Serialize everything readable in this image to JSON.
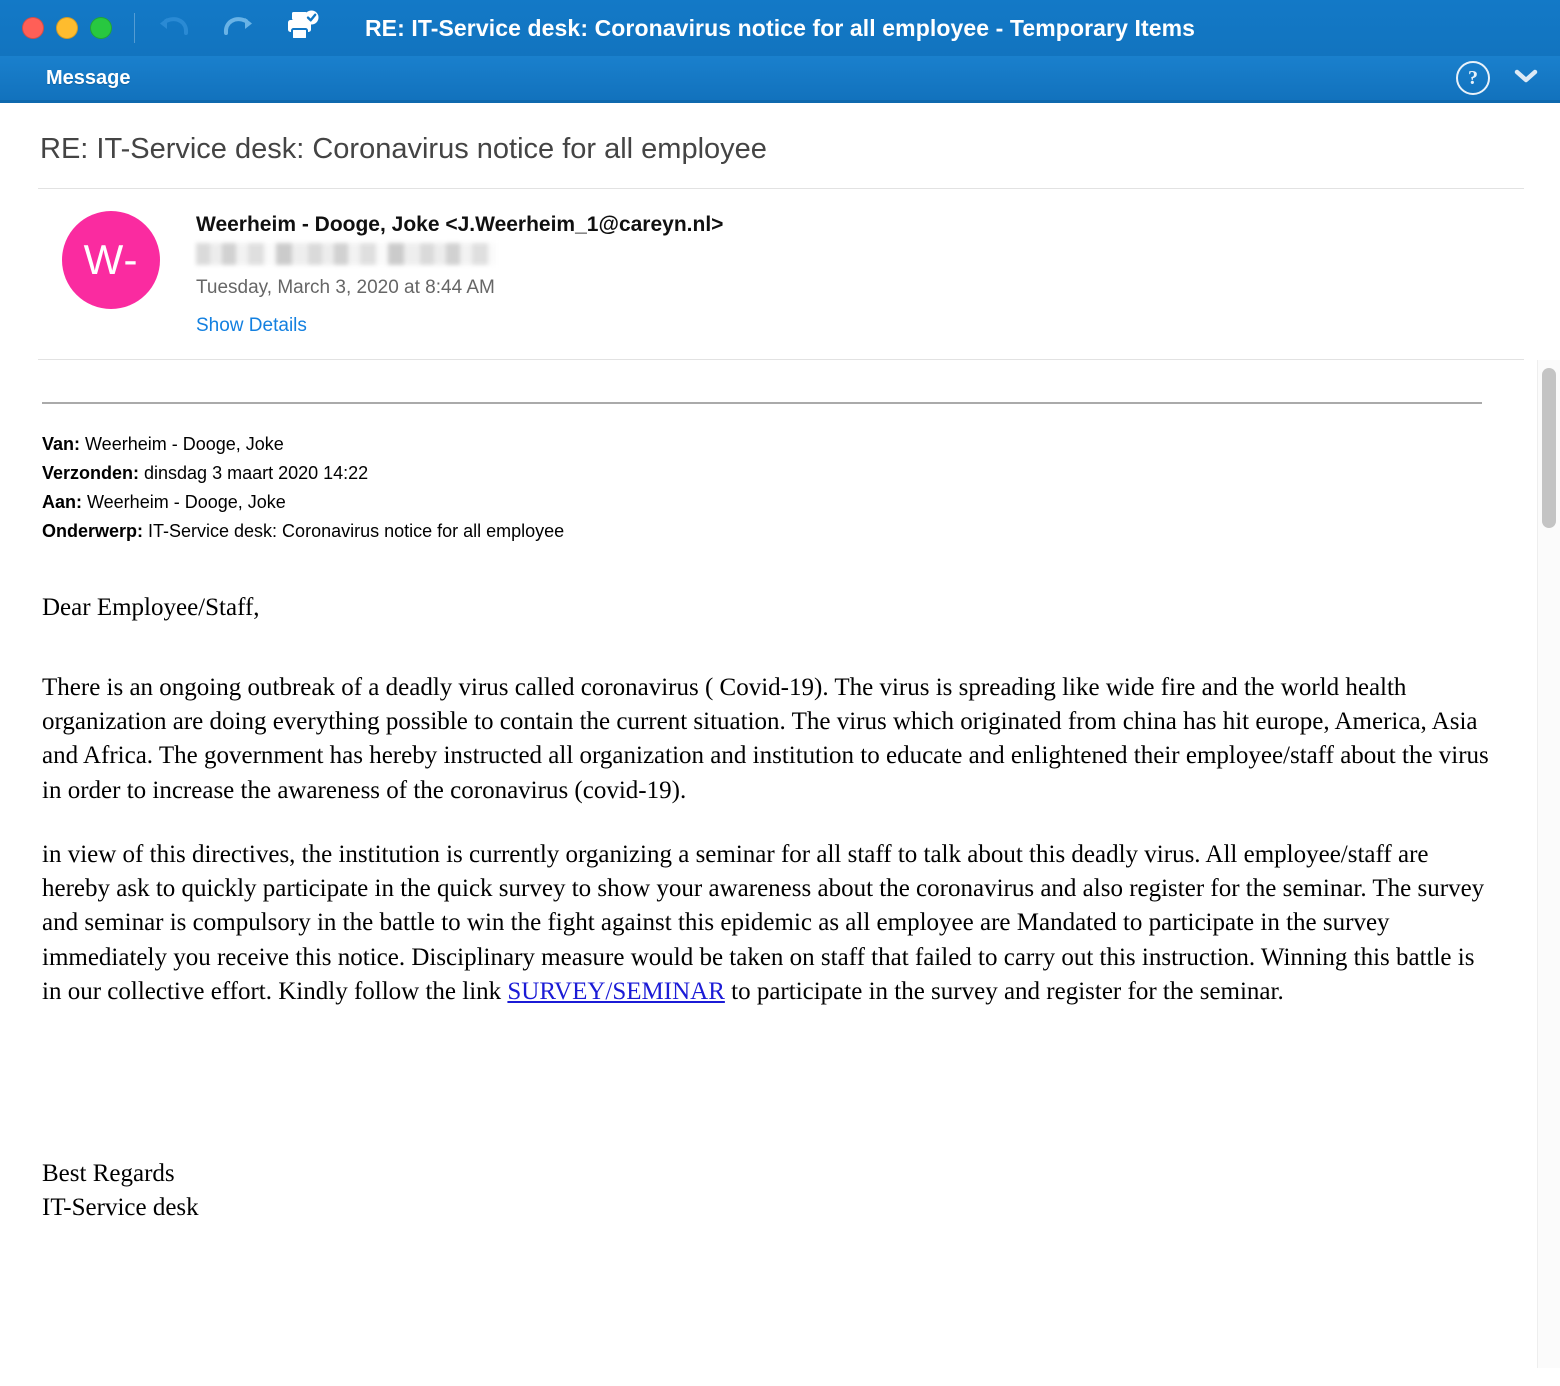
{
  "window": {
    "title": "RE: IT-Service desk: Coronavirus notice for all employee - Temporary Items",
    "traffic_lights": [
      {
        "name": "close",
        "color": "#ff5f57"
      },
      {
        "name": "minimize",
        "color": "#febc2e"
      },
      {
        "name": "zoom",
        "color": "#28c840"
      }
    ],
    "toolbar": [
      {
        "icon": "undo-icon",
        "label": "Undo"
      },
      {
        "icon": "redo-icon",
        "label": "Redo"
      },
      {
        "icon": "print-preview-icon",
        "label": "Print"
      }
    ],
    "accent_color": "#1277c4"
  },
  "ribbon": {
    "tab_label": "Message",
    "help_label": "?",
    "collapse_icon": "chevron-down-icon"
  },
  "message": {
    "subject": "RE: IT-Service desk: Coronavirus notice for all employee",
    "avatar_initials": "W-",
    "avatar_color": "#fa2ba0",
    "sender": "Weerheim - Dooge, Joke <J.Weerheim_1@careyn.nl>",
    "recipient_redacted": "",
    "date": "Tuesday, March 3, 2020 at 8:44 AM",
    "show_details_label": "Show Details"
  },
  "quoted_header": {
    "van_label": "Van:",
    "van_value": " Weerheim - Dooge, Joke",
    "verzonden_label": "Verzonden:",
    "verzonden_value": " dinsdag 3 maart 2020 14:22",
    "aan_label": "Aan:",
    "aan_value": " Weerheim - Dooge, Joke",
    "onderwerp_label": "Onderwerp:",
    "onderwerp_value": " IT-Service desk: Coronavirus notice for all employee"
  },
  "body": {
    "greeting": "Dear Employee/Staff,",
    "paragraph1": "There is an ongoing outbreak of a  deadly virus called coronavirus ( Covid-19). The virus is spreading like  wide fire and the world health organization are doing everything possible to contain the current situation. The virus which originated from china has hit europe, America, Asia and Africa. The government has hereby instructed all organization and institution to educate and enlightened their employee/staff about the virus in order to increase the awareness of the coronavirus (covid-19).",
    "paragraph2_before_link": "in view of this directives, the institution is currently organizing a seminar for all staff to talk about this deadly virus. All employee/staff are hereby ask to quickly participate in the quick survey to show your awareness about the coronavirus and also register for the seminar. The survey and seminar is compulsory in the battle to win the fight against this epidemic as all employee are Mandated to participate in the survey immediately you receive this notice. Disciplinary measure would be taken on staff that failed to carry out this instruction. Winning this battle is in our collective effort. Kindly follow the link ",
    "link_text": "SURVEY/SEMINAR",
    "paragraph2_after_link": " to participate in the survey and register for the seminar.",
    "signature_line1": "Best Regards",
    "signature_line2": "IT-Service desk"
  }
}
